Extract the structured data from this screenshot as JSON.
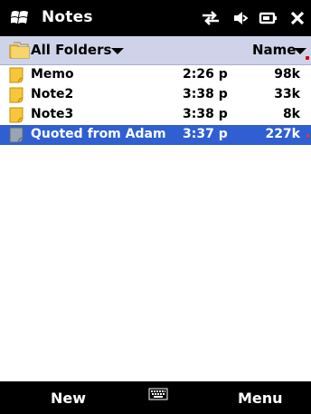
{
  "titlebar": {
    "title": "Notes"
  },
  "folderbar": {
    "folder_label": "All Folders",
    "sort_label": "Name"
  },
  "notes": [
    {
      "name": "Memo",
      "time": "2:26 p",
      "size": "98k",
      "selected": false
    },
    {
      "name": "Note2",
      "time": "3:38 p",
      "size": "33k",
      "selected": false
    },
    {
      "name": "Note3",
      "time": "3:38 p",
      "size": "8k",
      "selected": false
    },
    {
      "name": "Quoted from Adam",
      "time": "3:37 p",
      "size": "227k",
      "selected": true
    }
  ],
  "bottombar": {
    "left_label": "New",
    "right_label": "Menu"
  },
  "icons": {
    "start": "windows-logo",
    "connectivity": "sync-arrows",
    "volume": "speaker-mute",
    "battery": "battery",
    "close": "close-x",
    "keyboard": "keyboard"
  },
  "colors": {
    "titlebar_bg": "#000000",
    "folderbar_bg": "#cfd3ea",
    "selection_bg": "#2f5fd0",
    "note_icon": "#f7c63a"
  }
}
